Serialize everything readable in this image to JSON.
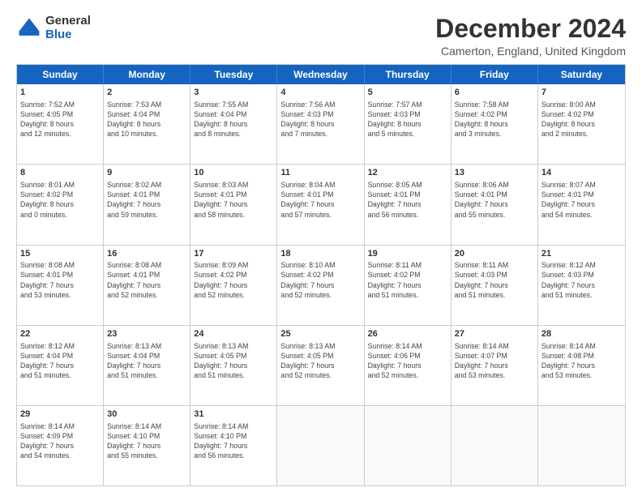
{
  "logo": {
    "general": "General",
    "blue": "Blue"
  },
  "title": "December 2024",
  "subtitle": "Camerton, England, United Kingdom",
  "headers": [
    "Sunday",
    "Monday",
    "Tuesday",
    "Wednesday",
    "Thursday",
    "Friday",
    "Saturday"
  ],
  "weeks": [
    [
      {
        "day": "1",
        "lines": [
          "Sunrise: 7:52 AM",
          "Sunset: 4:05 PM",
          "Daylight: 8 hours",
          "and 12 minutes."
        ]
      },
      {
        "day": "2",
        "lines": [
          "Sunrise: 7:53 AM",
          "Sunset: 4:04 PM",
          "Daylight: 8 hours",
          "and 10 minutes."
        ]
      },
      {
        "day": "3",
        "lines": [
          "Sunrise: 7:55 AM",
          "Sunset: 4:04 PM",
          "Daylight: 8 hours",
          "and 8 minutes."
        ]
      },
      {
        "day": "4",
        "lines": [
          "Sunrise: 7:56 AM",
          "Sunset: 4:03 PM",
          "Daylight: 8 hours",
          "and 7 minutes."
        ]
      },
      {
        "day": "5",
        "lines": [
          "Sunrise: 7:57 AM",
          "Sunset: 4:03 PM",
          "Daylight: 8 hours",
          "and 5 minutes."
        ]
      },
      {
        "day": "6",
        "lines": [
          "Sunrise: 7:58 AM",
          "Sunset: 4:02 PM",
          "Daylight: 8 hours",
          "and 3 minutes."
        ]
      },
      {
        "day": "7",
        "lines": [
          "Sunrise: 8:00 AM",
          "Sunset: 4:02 PM",
          "Daylight: 8 hours",
          "and 2 minutes."
        ]
      }
    ],
    [
      {
        "day": "8",
        "lines": [
          "Sunrise: 8:01 AM",
          "Sunset: 4:02 PM",
          "Daylight: 8 hours",
          "and 0 minutes."
        ]
      },
      {
        "day": "9",
        "lines": [
          "Sunrise: 8:02 AM",
          "Sunset: 4:01 PM",
          "Daylight: 7 hours",
          "and 59 minutes."
        ]
      },
      {
        "day": "10",
        "lines": [
          "Sunrise: 8:03 AM",
          "Sunset: 4:01 PM",
          "Daylight: 7 hours",
          "and 58 minutes."
        ]
      },
      {
        "day": "11",
        "lines": [
          "Sunrise: 8:04 AM",
          "Sunset: 4:01 PM",
          "Daylight: 7 hours",
          "and 57 minutes."
        ]
      },
      {
        "day": "12",
        "lines": [
          "Sunrise: 8:05 AM",
          "Sunset: 4:01 PM",
          "Daylight: 7 hours",
          "and 56 minutes."
        ]
      },
      {
        "day": "13",
        "lines": [
          "Sunrise: 8:06 AM",
          "Sunset: 4:01 PM",
          "Daylight: 7 hours",
          "and 55 minutes."
        ]
      },
      {
        "day": "14",
        "lines": [
          "Sunrise: 8:07 AM",
          "Sunset: 4:01 PM",
          "Daylight: 7 hours",
          "and 54 minutes."
        ]
      }
    ],
    [
      {
        "day": "15",
        "lines": [
          "Sunrise: 8:08 AM",
          "Sunset: 4:01 PM",
          "Daylight: 7 hours",
          "and 53 minutes."
        ]
      },
      {
        "day": "16",
        "lines": [
          "Sunrise: 8:08 AM",
          "Sunset: 4:01 PM",
          "Daylight: 7 hours",
          "and 52 minutes."
        ]
      },
      {
        "day": "17",
        "lines": [
          "Sunrise: 8:09 AM",
          "Sunset: 4:02 PM",
          "Daylight: 7 hours",
          "and 52 minutes."
        ]
      },
      {
        "day": "18",
        "lines": [
          "Sunrise: 8:10 AM",
          "Sunset: 4:02 PM",
          "Daylight: 7 hours",
          "and 52 minutes."
        ]
      },
      {
        "day": "19",
        "lines": [
          "Sunrise: 8:11 AM",
          "Sunset: 4:02 PM",
          "Daylight: 7 hours",
          "and 51 minutes."
        ]
      },
      {
        "day": "20",
        "lines": [
          "Sunrise: 8:11 AM",
          "Sunset: 4:03 PM",
          "Daylight: 7 hours",
          "and 51 minutes."
        ]
      },
      {
        "day": "21",
        "lines": [
          "Sunrise: 8:12 AM",
          "Sunset: 4:03 PM",
          "Daylight: 7 hours",
          "and 51 minutes."
        ]
      }
    ],
    [
      {
        "day": "22",
        "lines": [
          "Sunrise: 8:12 AM",
          "Sunset: 4:04 PM",
          "Daylight: 7 hours",
          "and 51 minutes."
        ]
      },
      {
        "day": "23",
        "lines": [
          "Sunrise: 8:13 AM",
          "Sunset: 4:04 PM",
          "Daylight: 7 hours",
          "and 51 minutes."
        ]
      },
      {
        "day": "24",
        "lines": [
          "Sunrise: 8:13 AM",
          "Sunset: 4:05 PM",
          "Daylight: 7 hours",
          "and 51 minutes."
        ]
      },
      {
        "day": "25",
        "lines": [
          "Sunrise: 8:13 AM",
          "Sunset: 4:05 PM",
          "Daylight: 7 hours",
          "and 52 minutes."
        ]
      },
      {
        "day": "26",
        "lines": [
          "Sunrise: 8:14 AM",
          "Sunset: 4:06 PM",
          "Daylight: 7 hours",
          "and 52 minutes."
        ]
      },
      {
        "day": "27",
        "lines": [
          "Sunrise: 8:14 AM",
          "Sunset: 4:07 PM",
          "Daylight: 7 hours",
          "and 53 minutes."
        ]
      },
      {
        "day": "28",
        "lines": [
          "Sunrise: 8:14 AM",
          "Sunset: 4:08 PM",
          "Daylight: 7 hours",
          "and 53 minutes."
        ]
      }
    ],
    [
      {
        "day": "29",
        "lines": [
          "Sunrise: 8:14 AM",
          "Sunset: 4:09 PM",
          "Daylight: 7 hours",
          "and 54 minutes."
        ]
      },
      {
        "day": "30",
        "lines": [
          "Sunrise: 8:14 AM",
          "Sunset: 4:10 PM",
          "Daylight: 7 hours",
          "and 55 minutes."
        ]
      },
      {
        "day": "31",
        "lines": [
          "Sunrise: 8:14 AM",
          "Sunset: 4:10 PM",
          "Daylight: 7 hours",
          "and 56 minutes."
        ]
      },
      {
        "day": "",
        "lines": []
      },
      {
        "day": "",
        "lines": []
      },
      {
        "day": "",
        "lines": []
      },
      {
        "day": "",
        "lines": []
      }
    ]
  ]
}
